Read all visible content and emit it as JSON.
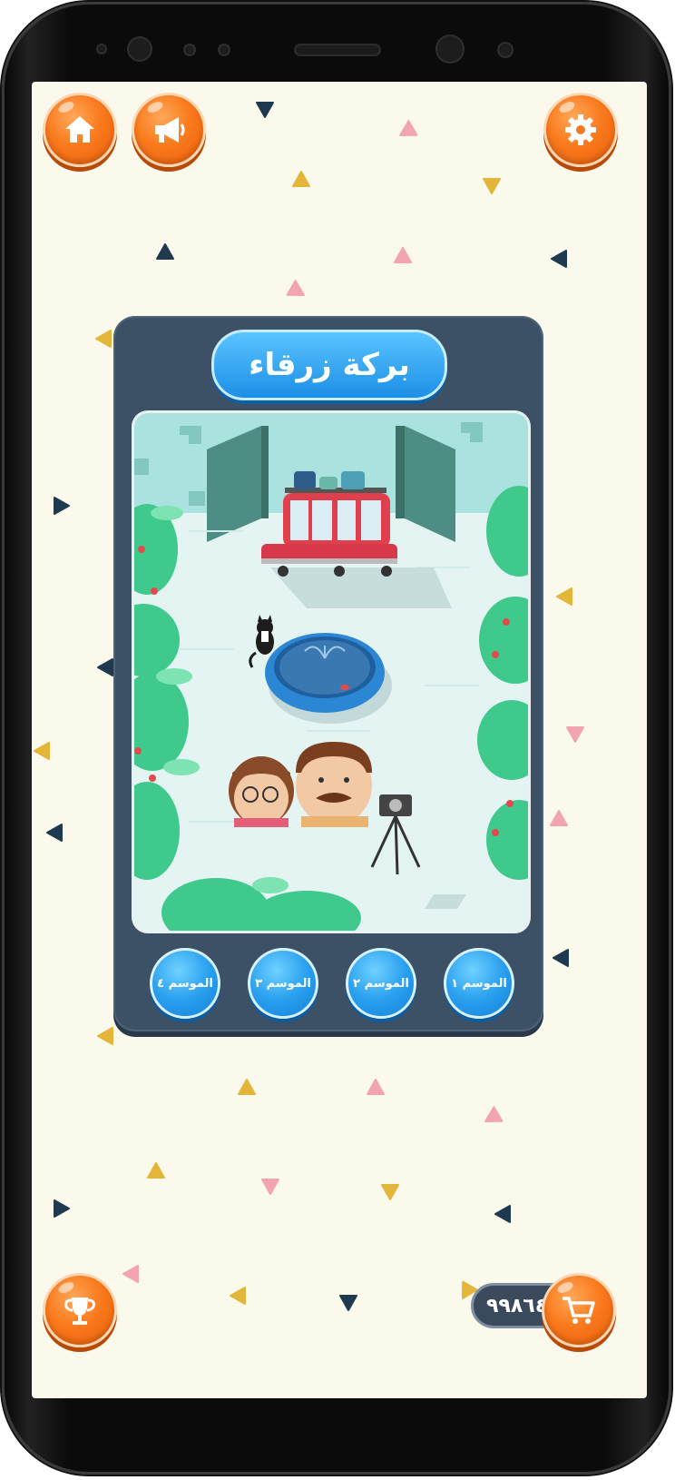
{
  "level_title": "بركة زرقاء",
  "seasons": [
    {
      "label": "الموسم ١"
    },
    {
      "label": "الموسم ٢"
    },
    {
      "label": "الموسم ٣"
    },
    {
      "label": "الموسم ٤"
    }
  ],
  "coins": "٩٩٨٦٤١",
  "icons": {
    "home": "home-icon",
    "sound": "megaphone-icon",
    "settings": "gear-icon",
    "trophy": "trophy-icon",
    "shop": "cart-icon"
  },
  "colors": {
    "background": "#fbf8ec",
    "orange_button": "#fa7a1c",
    "blue_button": "#2aa0ef",
    "panel": "#3d5166"
  }
}
